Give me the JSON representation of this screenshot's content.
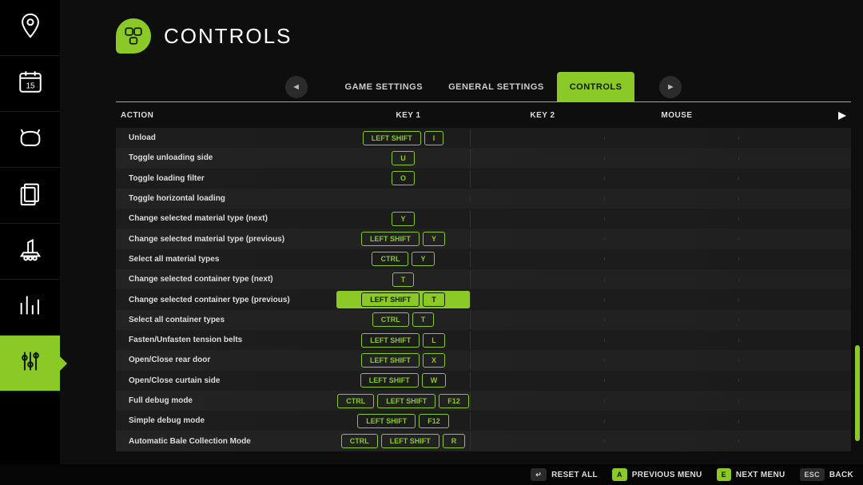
{
  "title": "CONTROLS",
  "tabs": {
    "items": [
      {
        "label": "GAME SETTINGS",
        "active": false
      },
      {
        "label": "GENERAL SETTINGS",
        "active": false
      },
      {
        "label": "CONTROLS",
        "active": true
      }
    ]
  },
  "columns": {
    "action": "ACTION",
    "key1": "KEY 1",
    "key2": "KEY 2",
    "mouse": "MOUSE"
  },
  "rows": [
    {
      "action": "Unload",
      "key1": [
        "LEFT SHIFT",
        "I"
      ],
      "key2": [],
      "mouse": [],
      "selected": false
    },
    {
      "action": "Toggle unloading side",
      "key1": [
        "U"
      ],
      "key2": [],
      "mouse": [],
      "selected": false
    },
    {
      "action": "Toggle loading filter",
      "key1": [
        "O"
      ],
      "key2": [],
      "mouse": [],
      "selected": false
    },
    {
      "action": "Toggle horizontal loading",
      "key1": [],
      "key2": [],
      "mouse": [],
      "selected": false
    },
    {
      "action": "Change selected material type (next)",
      "key1": [
        "Y"
      ],
      "key2": [],
      "mouse": [],
      "selected": false
    },
    {
      "action": "Change selected material type (previous)",
      "key1": [
        "LEFT SHIFT",
        "Y"
      ],
      "key2": [],
      "mouse": [],
      "selected": false
    },
    {
      "action": "Select all material types",
      "key1": [
        "CTRL",
        "Y"
      ],
      "key2": [],
      "mouse": [],
      "selected": false
    },
    {
      "action": "Change selected container type (next)",
      "key1": [
        "T"
      ],
      "key2": [],
      "mouse": [],
      "selected": false
    },
    {
      "action": "Change selected container type (previous)",
      "key1": [
        "LEFT SHIFT",
        "T"
      ],
      "key2": [],
      "mouse": [],
      "selected": true
    },
    {
      "action": "Select all container types",
      "key1": [
        "CTRL",
        "T"
      ],
      "key2": [],
      "mouse": [],
      "selected": false
    },
    {
      "action": "Fasten/Unfasten tension belts",
      "key1": [
        "LEFT SHIFT",
        "L"
      ],
      "key2": [],
      "mouse": [],
      "selected": false
    },
    {
      "action": "Open/Close rear door",
      "key1": [
        "LEFT SHIFT",
        "X"
      ],
      "key2": [],
      "mouse": [],
      "selected": false
    },
    {
      "action": "Open/Close curtain side",
      "key1": [
        "LEFT SHIFT",
        "W"
      ],
      "key2": [],
      "mouse": [],
      "selected": false
    },
    {
      "action": "Full debug mode",
      "key1": [
        "CTRL",
        "LEFT SHIFT",
        "F12"
      ],
      "key2": [],
      "mouse": [],
      "selected": false
    },
    {
      "action": "Simple debug mode",
      "key1": [
        "LEFT SHIFT",
        "F12"
      ],
      "key2": [],
      "mouse": [],
      "selected": false
    },
    {
      "action": "Automatic Bale Collection Mode",
      "key1": [
        "CTRL",
        "LEFT SHIFT",
        "R"
      ],
      "key2": [],
      "mouse": [],
      "selected": false
    }
  ],
  "sidebar": {
    "items": [
      {
        "name": "map-icon",
        "active": false
      },
      {
        "name": "calendar-icon",
        "active": false
      },
      {
        "name": "cow-icon",
        "active": false
      },
      {
        "name": "docs-icon",
        "active": false
      },
      {
        "name": "machine-icon",
        "active": false
      },
      {
        "name": "stats-icon",
        "active": false
      },
      {
        "name": "settings-icon",
        "active": true
      }
    ]
  },
  "footer": {
    "resetKey": "↵",
    "resetLabel": "RESET ALL",
    "prevKey": "A",
    "prevLabel": "PREVIOUS MENU",
    "nextKey": "E",
    "nextLabel": "NEXT MENU",
    "escKey": "ESC",
    "escLabel": "BACK"
  }
}
